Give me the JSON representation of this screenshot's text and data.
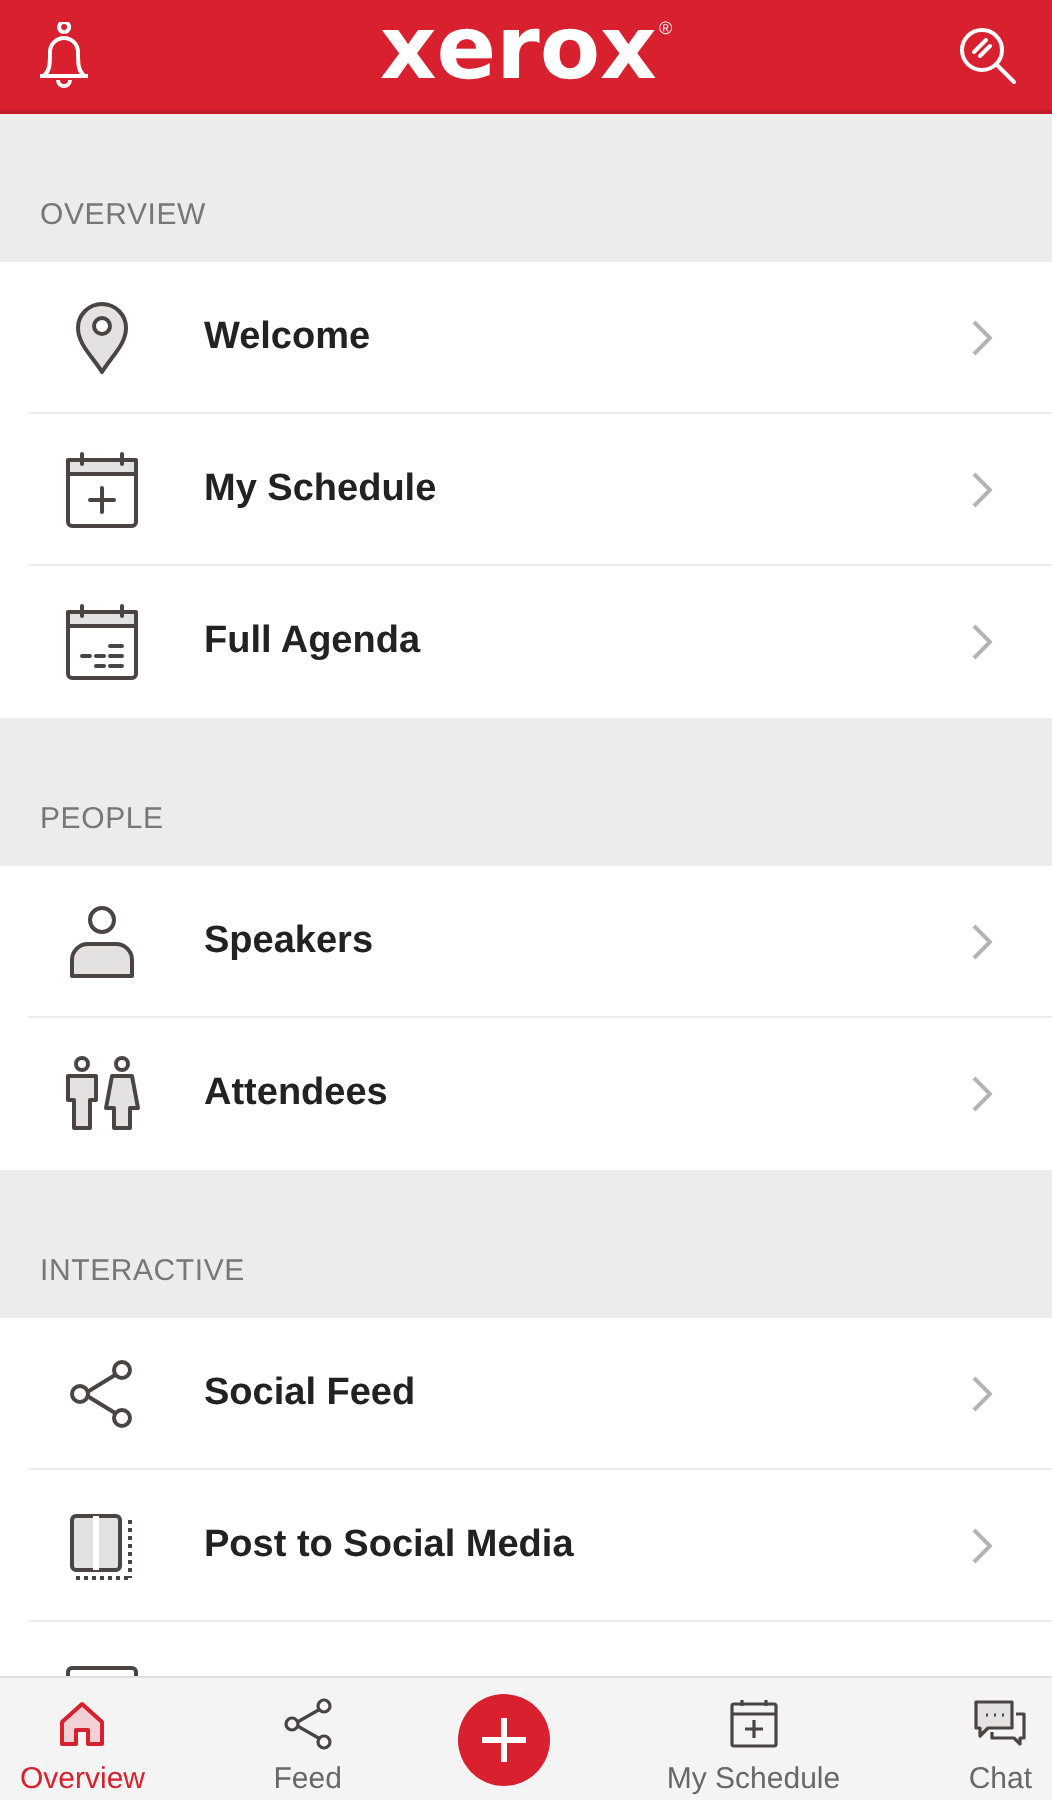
{
  "header": {
    "logo": "xerox",
    "logo_mark": "®"
  },
  "sections": [
    {
      "title": "OVERVIEW",
      "items": [
        {
          "kind": "row",
          "label": "Welcome"
        },
        {
          "kind": "row",
          "label": "My Schedule"
        },
        {
          "kind": "row",
          "label": "Full Agenda"
        }
      ]
    },
    {
      "title": "PEOPLE",
      "items": [
        {
          "kind": "row",
          "label": "Speakers"
        },
        {
          "kind": "row",
          "label": "Attendees"
        }
      ]
    },
    {
      "title": "INTERACTIVE",
      "items": [
        {
          "kind": "row",
          "label": "Social Feed"
        },
        {
          "kind": "row",
          "label": "Post to Social Media"
        },
        {
          "kind": "cut_off_row"
        }
      ]
    }
  ],
  "tab_bar": [
    {
      "kind": "tab",
      "label": "Overview",
      "selected": true
    },
    {
      "kind": "tab",
      "label": "Feed",
      "selected": false
    },
    {
      "kind": "add"
    },
    {
      "kind": "tab",
      "label": "My Schedule",
      "selected": false
    },
    {
      "kind": "tab",
      "label": "Chat",
      "selected": false
    }
  ]
}
